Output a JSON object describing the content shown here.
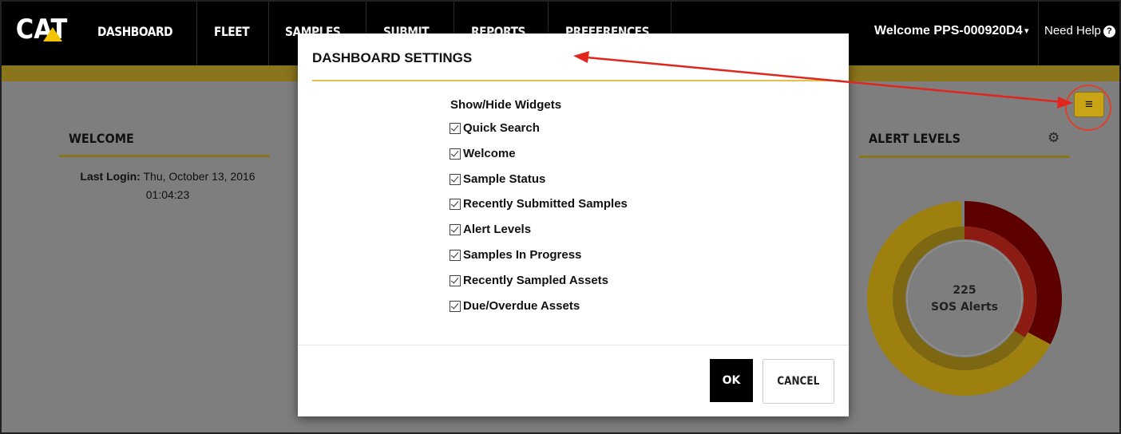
{
  "header": {
    "logo_text": "CAT",
    "nav": [
      "DASHBOARD",
      "FLEET",
      "SAMPLES",
      "SUBMIT",
      "REPORTS",
      "PREFERENCES"
    ],
    "welcome": "Welcome PPS-000920D4",
    "caret": "▾",
    "help": "Need Help"
  },
  "welcome_widget": {
    "title": "WELCOME",
    "last_login_label": "Last Login:",
    "last_login_value": "Thu, October 13, 2016",
    "last_login_time": "01:04:23"
  },
  "alert_widget": {
    "title": "ALERT LEVELS",
    "center_value": "225",
    "center_label": "SOS Alerts",
    "colors": {
      "outer_yellow": "#9e800e",
      "outer_red": "#5c0000",
      "inner_yellow": "#7d6712",
      "inner_red": "#8c1c12"
    }
  },
  "menu_button": {
    "label": "≡"
  },
  "modal": {
    "title": "DASHBOARD SETTINGS",
    "heading": "Show/Hide Widgets",
    "widgets": [
      "Quick Search",
      "Welcome",
      "Sample Status",
      "Recently Submitted Samples",
      "Alert Levels",
      "Samples In Progress",
      "Recently Sampled Assets",
      "Due/Overdue Assets"
    ],
    "ok_label": "OK",
    "cancel_label": "CANCEL"
  },
  "colors": {
    "accent": "#c8a416",
    "header_bg": "#000000",
    "annotation": "#e0261d"
  }
}
